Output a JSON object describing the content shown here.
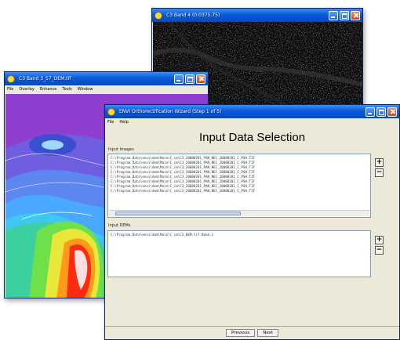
{
  "windows": {
    "image": {
      "title": "C3 Band 4 (0:0375.75)"
    },
    "dem": {
      "title": "C3 Band 3_57_DEM.tif",
      "menu": [
        "File",
        "Overlay",
        "Enhance",
        "Tools",
        "Window"
      ]
    },
    "wizard": {
      "title": "ENVI Orthorectification Wizard (Step 1 of 5)",
      "menu": [
        "File",
        "Help"
      ],
      "heading": "Input Data Selection",
      "input_images_label": "Input Images",
      "input_images": [
        "C:\\Program_Data\\envi\\dem\\Main\\C_cm\\C3_20080201_PAN_NEC_20080201_C_PSH.TIF",
        "C:\\Program_Data\\envi\\dem\\Main\\C_cm\\C3_20080201_PAN_NEC_20080201_C_PSH.TIF",
        "C:\\Program_Data\\envi\\dem\\Main\\C_cm\\C3_20080201_PAN_NEC_20080201_C_PSH.TIF",
        "C:\\Program_Data\\envi\\dem\\Main\\C_cm\\C3_20080201_PAN_NEC_20080201_C_PSH.TIF",
        "C:\\Program_Data\\envi\\dem\\Main\\C_cm\\C3_20080201_PAN_NEC_20080201_C_PSH.TIF",
        "C:\\Program_Data\\envi\\dem\\Main\\C_cm\\C3_20080201_PAN_NEC_20080201_C_PSH.TIF",
        "C:\\Program_Data\\envi\\dem\\Main\\C_cm\\C3_20080201_PAN_NEC_20080201_C_PSH.TIF",
        "C:\\Program_Data\\envi\\dem\\Main\\C_cm\\C3_20080201_PAN_NEC_20080201_C_PSH.TIF"
      ],
      "input_dem_label": "Input DEMs",
      "input_dems": [
        "C:\\Program_Data\\envi\\dem\\Main\\C_cm\\C3_DEM.tif Band 1"
      ],
      "add_label": "+",
      "remove_label": "−",
      "previous_label": "Previous",
      "next_label": "Next"
    }
  },
  "icons": {
    "app": "envi-app-icon",
    "minimize": "minimize-icon",
    "maximize": "maximize-icon",
    "close": "close-icon"
  },
  "colors": {
    "titlebar": "#0a5bd8",
    "dem_low": "#8f3fd0",
    "dem_high": "#ff2a10"
  }
}
